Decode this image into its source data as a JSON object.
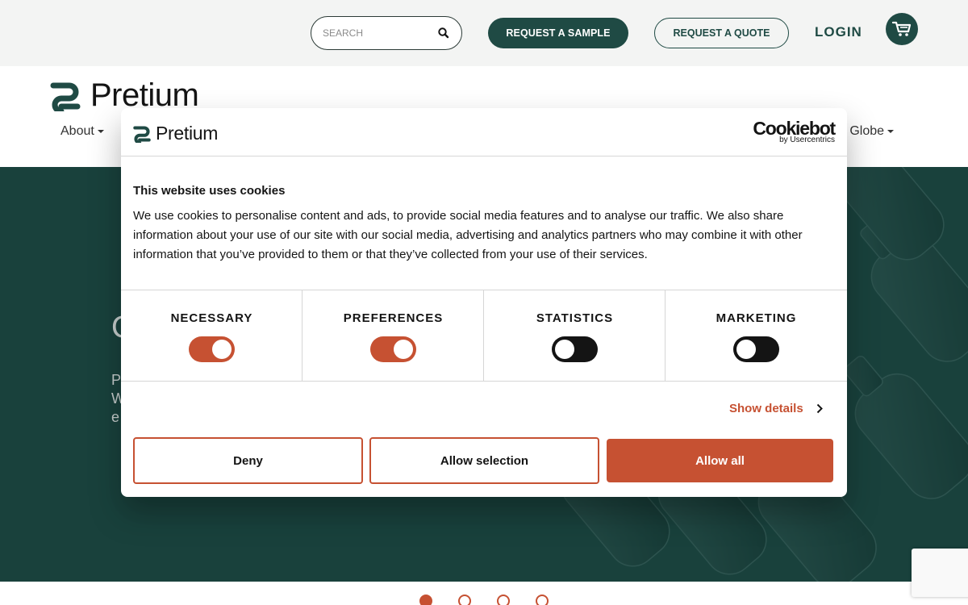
{
  "utility_bar": {
    "search_placeholder": "SEARCH",
    "request_sample_label": "REQUEST A SAMPLE",
    "request_quote_label": "REQUEST A QUOTE",
    "login_label": "LOGIN"
  },
  "header": {
    "logo_text": "Pretium",
    "nav": {
      "about_label": "About",
      "globe_label": "e Globe"
    }
  },
  "hero": {
    "partial_letters": [
      "C",
      "P",
      "W",
      "e"
    ]
  },
  "cookie_dialog": {
    "logo_text": "Pretium",
    "brand_title": "Cookiebot",
    "brand_sub": "by Usercentrics",
    "title": "This website uses cookies",
    "body": "We use cookies to personalise content and ads, to provide social media features and to analyse our traffic. We also share information about your use of our site with our social media, advertising and analytics partners who may combine it with other information that you’ve provided to them or that they’ve collected from your use of their services.",
    "categories": [
      {
        "label": "NECESSARY",
        "enabled": true
      },
      {
        "label": "PREFERENCES",
        "enabled": true
      },
      {
        "label": "STATISTICS",
        "enabled": false
      },
      {
        "label": "MARKETING",
        "enabled": false
      }
    ],
    "show_details_label": "Show details",
    "deny_label": "Deny",
    "allow_selection_label": "Allow selection",
    "allow_all_label": "Allow all"
  },
  "carousel": {
    "slide_count": 4,
    "active_index": 0
  },
  "colors": {
    "brand_green": "#1f4a44",
    "accent": "#c65132",
    "hero_bg": "#2d6e65",
    "toggle_off": "#141414"
  },
  "icons": {
    "search": "search-icon",
    "cart": "cart-icon",
    "chevron": "chevron-right-icon",
    "logo_mark": "pretium-logo-mark"
  }
}
